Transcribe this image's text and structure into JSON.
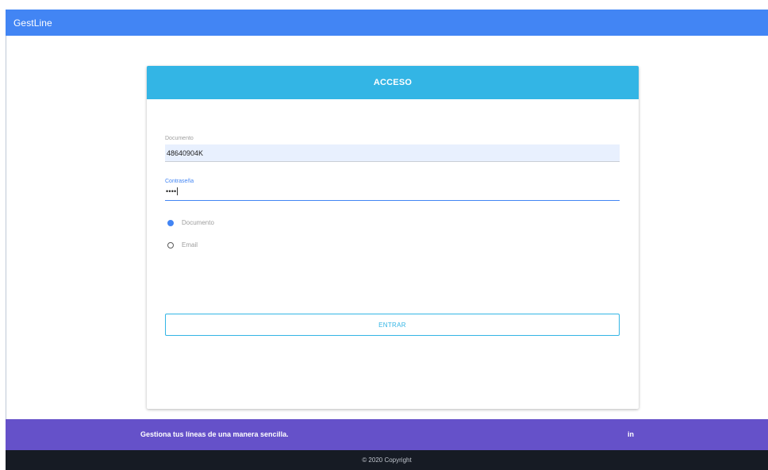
{
  "app": {
    "brand": "GestLine"
  },
  "login": {
    "title": "ACCESO",
    "document_label": "Documento",
    "document_value": "48640904K",
    "password_label": "Contraseña",
    "password_value": "••••",
    "options": [
      {
        "label": "Documento",
        "selected": true
      },
      {
        "label": "Email",
        "selected": false
      }
    ],
    "submit_label": "ENTRAR"
  },
  "footer": {
    "tagline": "Gestiona tus líneas de una manera sencilla.",
    "social_label": "in",
    "copyright": "© 2020 Copyright"
  },
  "colors": {
    "navbar": "#4285f4",
    "card_header": "#33b5e5",
    "footer": "#6551c9",
    "copyright_bar": "#161b24"
  },
  "icons": {
    "social": "linkedin-icon"
  }
}
